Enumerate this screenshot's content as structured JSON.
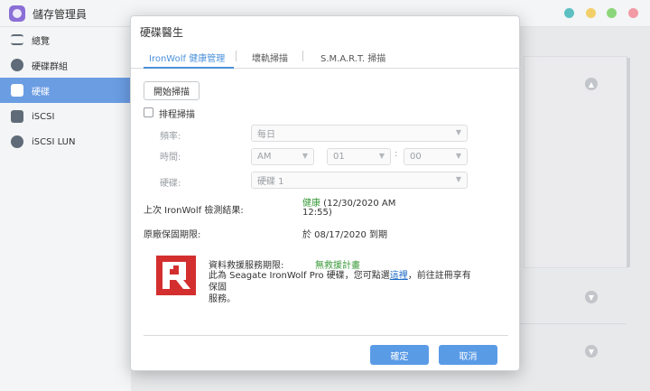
{
  "app": {
    "title": "儲存管理員"
  },
  "sidebar": {
    "items": [
      {
        "label": "總覽",
        "icon": "overview-icon"
      },
      {
        "label": "硬碟群組",
        "icon": "disk-group-icon"
      },
      {
        "label": "硬碟",
        "icon": "hdd-icon",
        "active": true
      },
      {
        "label": "iSCSI",
        "icon": "iscsi-icon"
      },
      {
        "label": "iSCSI LUN",
        "icon": "iscsi-lun-icon"
      }
    ]
  },
  "dialog": {
    "title": "硬碟醫生",
    "tabs": [
      {
        "label": "IronWolf 健康管理",
        "active": true
      },
      {
        "label": "壞軌掃描"
      },
      {
        "label": "S.M.A.R.T. 掃描"
      }
    ],
    "start_scan_label": "開始掃描",
    "schedule_label": "排程掃描",
    "frequency_label": "頻率:",
    "frequency_value": "每日",
    "time_label": "時間:",
    "time_ampm": "AM",
    "time_hour": "01",
    "time_minute": "00",
    "time_colon": ":",
    "disk_label": "硬碟:",
    "disk_value": "硬碟 1",
    "last_result_label": "上次 IronWolf 檢測結果:",
    "last_result_status": "健康",
    "last_result_time": " (12/30/2020 AM",
    "last_result_time2": "12:55)",
    "warranty_label": "原廠保固期限:",
    "warranty_value": "於 08/17/2020 到期",
    "rescue_label": "資料救援服務期限:",
    "rescue_value": "無救援計畫",
    "rescue_desc_before": "此為 Seagate IronWolf Pro 硬碟，您可點選",
    "rescue_link": "這裡",
    "rescue_desc_after": "，前往註冊享有保固",
    "rescue_desc_line2": "服務。",
    "ok_label": "確定",
    "cancel_label": "取消"
  },
  "colors": {
    "accent": "#5a9be6",
    "sidebar_active": "#6b9de3",
    "healthy_green": "#3a9a3a",
    "logo_red": "#d32f2f"
  }
}
